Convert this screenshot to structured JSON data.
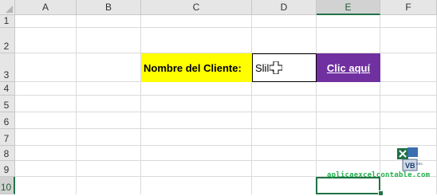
{
  "sheet": {
    "columns": [
      "A",
      "B",
      "C",
      "D",
      "E",
      "F"
    ],
    "rows": [
      "1",
      "2",
      "3",
      "4",
      "5",
      "6",
      "7",
      "8",
      "9",
      "10"
    ],
    "active_column": "E",
    "active_row": "10"
  },
  "cells": {
    "label_text": "Nombre del Cliente:",
    "input_value": "Slil a",
    "button_label": "Clic aquí"
  },
  "colors": {
    "label_background": "#ffff00",
    "button_background": "#7030a0",
    "selection_border": "#217346",
    "watermark": "#22b14c"
  },
  "logo": {
    "name": "excel-vba-logo",
    "text": "VB",
    "small_text": "ERC"
  },
  "watermark": {
    "text": "aplicaexcelcontable.com"
  }
}
